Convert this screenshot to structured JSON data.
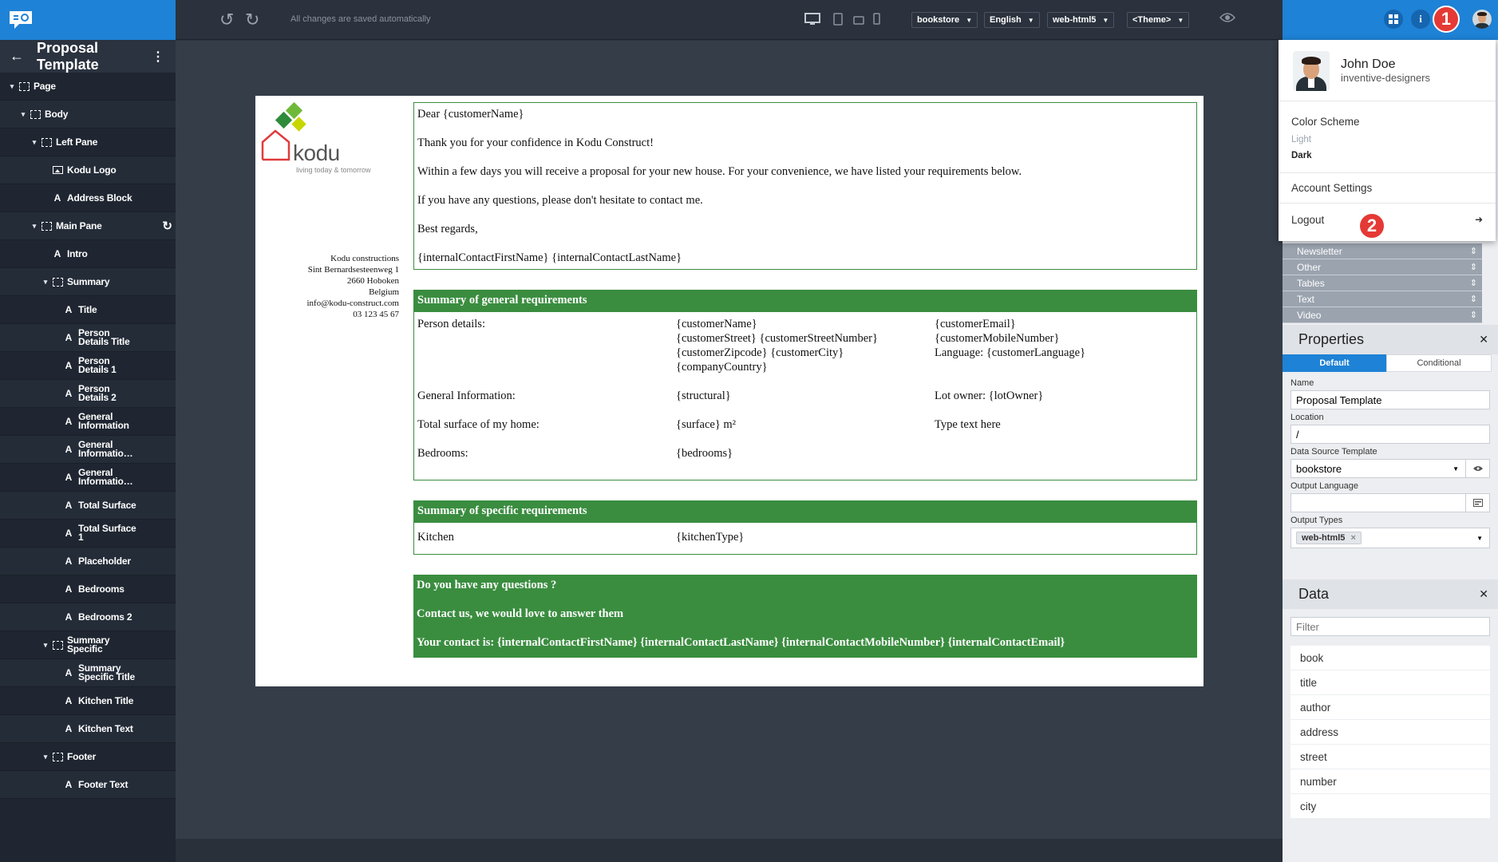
{
  "app": {
    "title": "Proposal Template"
  },
  "toolbar": {
    "saved_status": "All changes are saved automatically",
    "dropdowns": [
      "bookstore",
      "English",
      "web-html5",
      "<Theme>"
    ]
  },
  "tree": [
    {
      "label": "Page",
      "level": 0,
      "icon": "frame-icon",
      "caret": "▾"
    },
    {
      "label": "Body",
      "level": 1,
      "icon": "frame-icon",
      "caret": "▾"
    },
    {
      "label": "Left Pane",
      "level": 2,
      "icon": "frame-icon",
      "caret": "▾"
    },
    {
      "label": "Kodu Logo",
      "level": 3,
      "icon": "image-icon",
      "caret": ""
    },
    {
      "label": "Address Block",
      "level": 3,
      "icon": "text-icon",
      "caret": ""
    },
    {
      "label": "Main Pane",
      "level": 2,
      "icon": "frame-icon",
      "caret": "▾",
      "refresh": true
    },
    {
      "label": "Intro",
      "level": 3,
      "icon": "text-icon",
      "caret": ""
    },
    {
      "label": "Summary",
      "level": 3,
      "icon": "frame-icon",
      "caret": "▾"
    },
    {
      "label": "Title",
      "level": 4,
      "icon": "text-icon",
      "caret": ""
    },
    {
      "label": "Person\nDetails Title",
      "level": 4,
      "icon": "text-icon",
      "caret": ""
    },
    {
      "label": "Person\nDetails 1",
      "level": 4,
      "icon": "text-icon",
      "caret": ""
    },
    {
      "label": "Person\nDetails 2",
      "level": 4,
      "icon": "text-icon",
      "caret": ""
    },
    {
      "label": "General\nInformation",
      "level": 4,
      "icon": "text-icon",
      "caret": ""
    },
    {
      "label": "General\nInformatio…",
      "level": 4,
      "icon": "text-icon",
      "caret": ""
    },
    {
      "label": "General\nInformatio…",
      "level": 4,
      "icon": "text-icon",
      "caret": ""
    },
    {
      "label": "Total Surface",
      "level": 4,
      "icon": "text-icon",
      "caret": ""
    },
    {
      "label": "Total Surface\n1",
      "level": 4,
      "icon": "text-icon",
      "caret": ""
    },
    {
      "label": "Placeholder",
      "level": 4,
      "icon": "text-icon",
      "caret": ""
    },
    {
      "label": "Bedrooms",
      "level": 4,
      "icon": "text-icon",
      "caret": ""
    },
    {
      "label": "Bedrooms 2",
      "level": 4,
      "icon": "text-icon",
      "caret": ""
    },
    {
      "label": "Summary\nSpecific",
      "level": 3,
      "icon": "frame-icon",
      "caret": "▾"
    },
    {
      "label": "Summary\nSpecific Title",
      "level": 4,
      "icon": "text-icon",
      "caret": ""
    },
    {
      "label": "Kitchen Title",
      "level": 4,
      "icon": "text-icon",
      "caret": ""
    },
    {
      "label": "Kitchen Text",
      "level": 4,
      "icon": "text-icon",
      "caret": ""
    },
    {
      "label": "Footer",
      "level": 3,
      "icon": "frame-icon",
      "caret": "▾"
    },
    {
      "label": "Footer Text",
      "level": 4,
      "icon": "text-icon",
      "caret": ""
    }
  ],
  "doc": {
    "logo_word": "kodu",
    "logo_tagline": "living today & tomorrow",
    "address": [
      "Kodu constructions",
      "Sint Bernardsesteenweg 1",
      "2660 Hoboken",
      "Belgium",
      "info@kodu-construct.com",
      "03 123 45 67"
    ],
    "intro": [
      "Dear {customerName}",
      "Thank you for your confidence in Kodu Construct!",
      "Within a few days you will receive a proposal for your new house. For your convenience, we have listed your requirements below.",
      "If you have any questions, please don't hesitate to contact me.",
      "Best regards,",
      "{internalContactFirstName} {internalContactLastName}"
    ],
    "summary_title": "Summary of general requirements",
    "summary_rows": [
      [
        "Person details:",
        "{customerName}\n{customerStreet} {customerStreetNumber}\n{customerZipcode} {customerCity}\n{companyCountry}",
        "{customerEmail}\n{customerMobileNumber}\nLanguage: {customerLanguage}"
      ],
      [
        "General Information:",
        "{structural}",
        "Lot owner: {lotOwner}"
      ],
      [
        "Total surface of my home:",
        "{surface} m²",
        "Type text here"
      ],
      [
        "Bedrooms:",
        "{bedrooms}",
        ""
      ]
    ],
    "specific_title": "Summary of specific requirements",
    "kitchen_label": "Kitchen",
    "kitchen_value": "{kitchenType}",
    "footer": [
      "Do you have any questions ?",
      "Contact us, we would love to answer them",
      "Your contact is: {internalContactFirstName} {internalContactLastName} {internalContactMobileNumber} {internalContactEmail}"
    ]
  },
  "user_menu": {
    "name": "John Doe",
    "org": "inventive-designers",
    "color_scheme_label": "Color Scheme",
    "scheme_light": "Light",
    "scheme_dark": "Dark",
    "account_settings": "Account Settings",
    "logout": "Logout"
  },
  "badges": {
    "one": "1",
    "two": "2"
  },
  "components_list": [
    "Newsletter",
    "Other",
    "Tables",
    "Text",
    "Video"
  ],
  "properties": {
    "title": "Properties",
    "tab_default": "Default",
    "tab_conditional": "Conditional",
    "name_label": "Name",
    "name_value": "Proposal Template",
    "location_label": "Location",
    "location_value": "/",
    "dst_label": "Data Source Template",
    "dst_value": "bookstore",
    "output_language_label": "Output Language",
    "output_language_value": "",
    "output_types_label": "Output Types",
    "output_types_chip": "web-html5"
  },
  "data_section": {
    "title": "Data",
    "filter_placeholder": "Filter",
    "items": [
      "book",
      "title",
      "author",
      "address",
      "street",
      "number",
      "city"
    ]
  },
  "colors": {
    "accent_blue": "#1e82d6",
    "doc_green": "#3a8d3f",
    "badge_red": "#e53935",
    "sidebar_bg": "#1f2631"
  }
}
